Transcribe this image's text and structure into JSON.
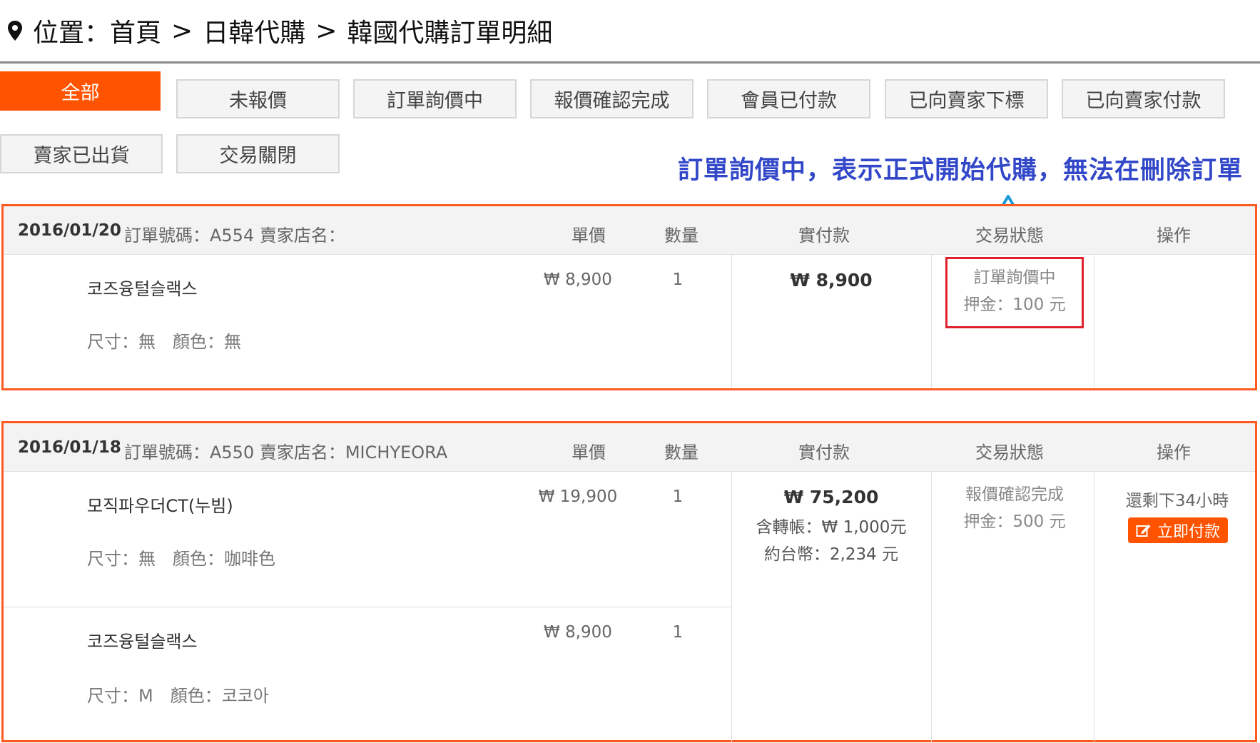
{
  "breadcrumb": {
    "prefix": "位置：",
    "items": [
      "首頁",
      "日韓代購",
      "韓國代購訂單明細"
    ],
    "separator": ">"
  },
  "tabs": [
    "全部",
    "未報價",
    "訂單詢價中",
    "報價確認完成",
    "會員已付款",
    "已向賣家下標",
    "已向賣家付款",
    "賣家已出貨",
    "交易關閉"
  ],
  "annotation": "訂單詢價中，表示正式開始代購，無法在刪除訂單",
  "columns": {
    "unit_price": "單價",
    "quantity": "數量",
    "paid": "實付款",
    "status": "交易狀態",
    "action": "操作"
  },
  "orders": [
    {
      "date": "2016/01/20",
      "info": "訂單號碼：A554 賣家店名：",
      "items": [
        {
          "name": "코즈융털슬랙스",
          "spec": "尺寸：無　顏色：無",
          "price": "₩ 8,900",
          "qty": "1"
        }
      ],
      "paid": "₩ 8,900",
      "status": "訂單詢價中",
      "deposit": "押金：100 元"
    },
    {
      "date": "2016/01/18",
      "info": "訂單號碼：A550 賣家店名：MICHYEORA",
      "items": [
        {
          "name": "모직파우더CT(누빔)",
          "spec": "尺寸：無　顏色：咖啡色",
          "price": "₩ 19,900",
          "qty": "1"
        },
        {
          "name": "코즈융털슬랙스",
          "spec": "尺寸：M　顏色：코코아",
          "price": "₩ 8,900",
          "qty": "1"
        }
      ],
      "paid": "₩ 75,200",
      "transfer": "含轉帳：₩ 1,000元",
      "twd": "約台幣：2,234 元",
      "status": "報價確認完成",
      "deposit": "押金：500 元",
      "remaining": "還剩下34小時",
      "pay_button": "立即付款"
    }
  ],
  "colors": {
    "accent": "#ff5300",
    "note": "#3348c8",
    "highlight": "#e0202c",
    "arrow": "#1e9ad6"
  },
  "icons": [
    "location-pin-icon",
    "up-arrow-icon",
    "edit-icon"
  ]
}
